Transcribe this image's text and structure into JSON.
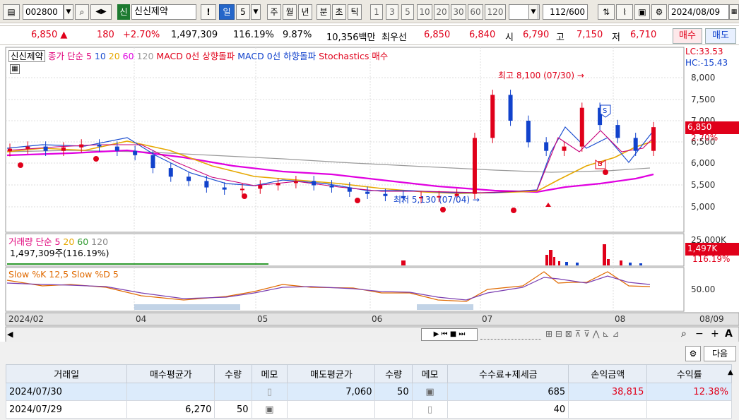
{
  "toolbar": {
    "code": "002800",
    "badge": "신",
    "name": "신신제약",
    "excl": "!",
    "periods": [
      "일",
      "5",
      "주",
      "월",
      "년",
      "분",
      "초",
      "틱"
    ],
    "nums": [
      "1",
      "3",
      "5",
      "10",
      "20",
      "30",
      "60",
      "120"
    ],
    "count": "112",
    "countmax": "/600",
    "date": "2024/08/09"
  },
  "price": {
    "cur": "6,850 ▲",
    "chg": "180",
    "pct": "+2.70%",
    "vol": "1,497,309",
    "volratio": "116.19%",
    "rate": "9.87%",
    "amount": "10,356백만",
    "best": "최우선",
    "ask": "6,850",
    "bid": "6,840",
    "open_l": "시",
    "open": "6,790",
    "high_l": "고",
    "high": "7,150",
    "low_l": "저",
    "low": "6,710",
    "sell": "매수",
    "buy": "매도"
  },
  "legend": {
    "stock": "신신제약",
    "ma": "종가 단순 5",
    "ma10": "10",
    "ma20": "20",
    "ma60": "60",
    "ma120": "120",
    "macd1": "MACD 0선 상향돌파",
    "macd2": "MACD 0선 하향돌파",
    "stoch": "Stochastics 매수",
    "vol": "거래량 단순 5",
    "vol20": "20",
    "vol60": "60",
    "vol120": "120",
    "volval": "1,497,309주(116.19%)",
    "slow": "Slow %K 12,5  Slow %D 5"
  },
  "axis": {
    "lc": "LC:33.53",
    "hc": "HC:-15.43",
    "prices": [
      "8,000",
      "7,500",
      "7,000",
      "6,500",
      "6,000",
      "5,500",
      "5,000"
    ],
    "cur_tag": "6,850",
    "pct_tag": "2.70%",
    "vol_max": "25,000K",
    "vol_tag": "1,497K",
    "vol_pct": "116.19%",
    "stoch": "50.00",
    "dates": [
      "2024/02",
      "04",
      "05",
      "06",
      "07",
      "08"
    ],
    "end": "08/09"
  },
  "notes": {
    "high": "최고 8,100 (07/30) →",
    "low": "최저 5,130 (07/04) →"
  },
  "grid_ctrl": {
    "next": "다음"
  },
  "table": {
    "headers": [
      "거래일",
      "매수평균가",
      "수량",
      "메모",
      "매도평균가",
      "수량",
      "메모",
      "수수료+제세금",
      "손익금액",
      "수익률"
    ],
    "rows": [
      [
        "2024/07/30",
        "",
        "",
        "",
        "7,060",
        "50",
        "",
        "685",
        "38,815",
        "12.38%"
      ],
      [
        "2024/07/29",
        "6,270",
        "50",
        "",
        "",
        "",
        "",
        "40",
        "",
        ""
      ]
    ]
  },
  "colors": {
    "up": "#e0001a",
    "down": "#1142cc",
    "ma5": "#e0007a",
    "ma20": "#e6a800",
    "ma60": "#e000e0",
    "ma120": "#888888"
  },
  "chart_data": {
    "type": "candlestick",
    "title": "신신제약",
    "ylim": [
      4500,
      8500
    ],
    "annotations": [
      {
        "text": "최고 8,100 (07/30)",
        "value": 8100
      },
      {
        "text": "최저 5,130 (07/04)",
        "value": 5130
      }
    ],
    "series": [
      {
        "name": "종가",
        "values": [
          6350,
          6400,
          6300,
          6380,
          6450,
          6400,
          6300,
          6200,
          5900,
          5700,
          5600,
          5450,
          5400,
          5420,
          5500,
          5550,
          5600,
          5500,
          5450,
          5350,
          5300,
          5250,
          5200,
          5230,
          5250,
          5300,
          6600,
          7600,
          7000,
          6500,
          6300,
          6400,
          7300,
          6900,
          6600,
          6300,
          6850
        ]
      },
      {
        "name": "MA60",
        "values": [
          6200,
          6220,
          6250,
          6260,
          6270,
          6260,
          6240,
          6200,
          6150,
          6100,
          6050,
          6000,
          5960,
          5920,
          5880,
          5850,
          5820,
          5790,
          5760,
          5730,
          5700,
          5680,
          5650,
          5630,
          5620,
          5610,
          5600,
          5640,
          5680,
          5700,
          5720,
          5740,
          5760,
          5790,
          5810,
          5840,
          5870
        ]
      },
      {
        "name": "MA120",
        "values": [
          6300,
          6300,
          6290,
          6280,
          6270,
          6260,
          6240,
          6220,
          6200,
          6180,
          6150,
          6120,
          6100,
          6080,
          6060,
          6040,
          6020,
          6000,
          5990,
          5980,
          5970,
          5960,
          5950,
          5940,
          5930,
          5920,
          5920,
          5925,
          5930,
          5930,
          5935,
          5940,
          5945,
          5950,
          5955,
          5960,
          5960
        ]
      }
    ]
  }
}
